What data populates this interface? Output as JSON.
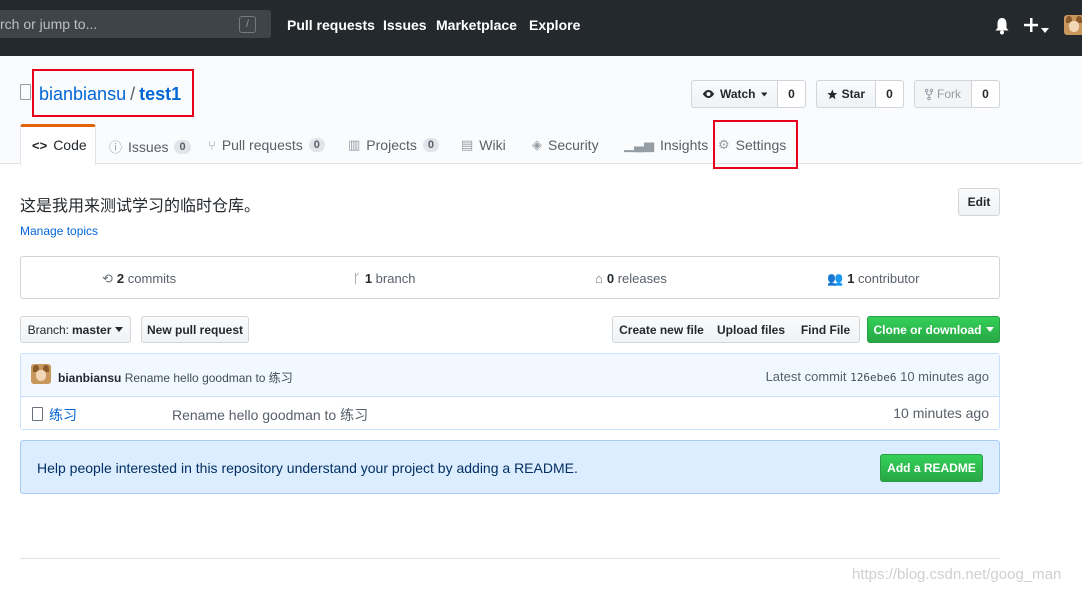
{
  "header": {
    "search_placeholder": "rch or jump to...",
    "slash_hint": "/",
    "nav": [
      "Pull requests",
      "Issues",
      "Marketplace",
      "Explore"
    ],
    "icons": [
      "bell-icon",
      "plus-icon",
      "caret-down-icon",
      "avatar"
    ]
  },
  "repo": {
    "owner": "bianbiansu",
    "separator": "/",
    "name": "test1",
    "watch_label": "Watch",
    "watch_count": "0",
    "star_label": "Star",
    "star_count": "0",
    "fork_label": "Fork",
    "fork_count": "0"
  },
  "tabs": [
    {
      "label": "Code"
    },
    {
      "label": "Issues",
      "count": "0"
    },
    {
      "label": "Pull requests",
      "count": "0"
    },
    {
      "label": "Projects",
      "count": "0"
    },
    {
      "label": "Wiki"
    },
    {
      "label": "Security"
    },
    {
      "label": "Insights"
    },
    {
      "label": "Settings"
    }
  ],
  "about": {
    "description": "这是我用来测试学习的临时仓库。",
    "manage_topics": "Manage topics",
    "edit_label": "Edit"
  },
  "summary": {
    "commits_num": "2",
    "commits_label": "commits",
    "branch_num": "1",
    "branch_label": "branch",
    "releases_num": "0",
    "releases_label": "releases",
    "contributor_num": "1",
    "contributor_label": "contributor"
  },
  "file_nav": {
    "branch_prefix": "Branch:",
    "branch_name": "master",
    "new_pr": "New pull request",
    "create_file": "Create new file",
    "upload_files": "Upload files",
    "find_file": "Find File",
    "clone": "Clone or download"
  },
  "commit": {
    "author": "bianbiansu",
    "message": "Rename hello goodman to 练习",
    "latest_label": "Latest commit",
    "sha": "126ebe6",
    "age": "10 minutes ago"
  },
  "files": [
    {
      "name": "练习",
      "message": "Rename hello goodman to 练习",
      "age": "10 minutes ago"
    }
  ],
  "readme": {
    "prompt": "Help people interested in this repository understand your project by adding a README.",
    "button": "Add a README"
  },
  "watermark": "https://blog.csdn.net/goog_man",
  "colors": {
    "link": "#0366d6",
    "header": "#24292e",
    "green": "#28a745",
    "highlight": "#e8001c",
    "tab_accent": "#e36209"
  }
}
